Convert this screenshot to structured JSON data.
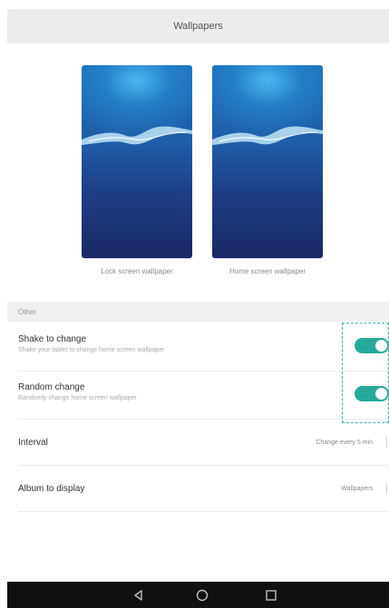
{
  "header": {
    "title": "Wallpapers"
  },
  "previews": {
    "lock_label": "Lock screen wallpaper",
    "home_label": "Home screen wallpaper"
  },
  "section": {
    "title": "Other"
  },
  "settings": {
    "shake": {
      "title": "Shake to change",
      "subtitle": "Shake your tablet to change home screen wallpaper",
      "enabled": true
    },
    "random": {
      "title": "Random change",
      "subtitle": "Randomly change home screen wallpaper",
      "enabled": true
    },
    "interval": {
      "title": "Interval",
      "value": "Change every 5 min"
    },
    "album": {
      "title": "Album to display",
      "value": "Wallpapers"
    }
  },
  "navbar": {
    "icons": [
      "back-icon",
      "home-icon",
      "recents-icon"
    ]
  },
  "colors": {
    "accent": "#27a99a",
    "highlight": "#3ab0b4",
    "header_bg": "#ededed",
    "navbar_bg": "#101010"
  }
}
